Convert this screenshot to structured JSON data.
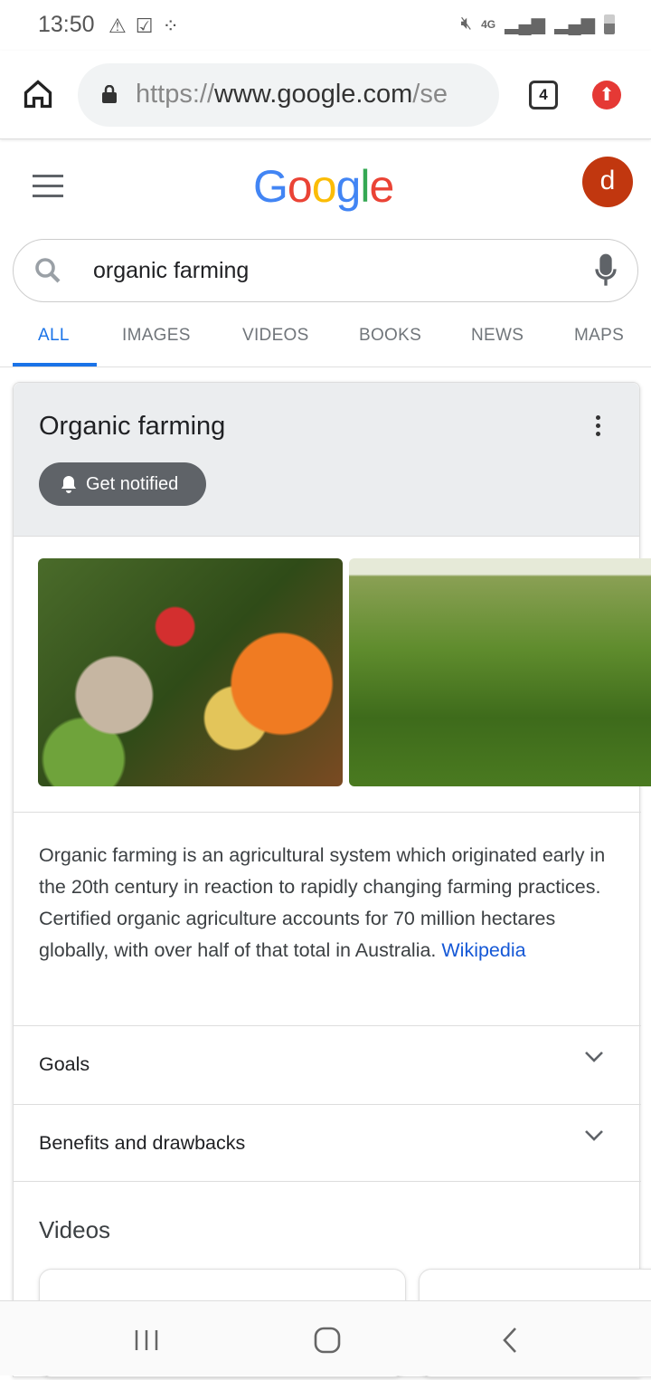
{
  "status_bar": {
    "time": "13:50",
    "left_icons": [
      "warning-icon",
      "checkbox-icon",
      "download-icon"
    ],
    "right_icons": [
      "mute-icon",
      "4g-icon",
      "signal-icon",
      "signal-icon",
      "battery-icon"
    ],
    "network": "4G"
  },
  "browser": {
    "url_scheme": "https://",
    "url_host": "www.google.com",
    "url_rest": "/se",
    "tab_count": "4"
  },
  "google": {
    "logo": "Google",
    "avatar_letter": "d",
    "search_query": "organic farming"
  },
  "tabs": [
    {
      "label": "ALL",
      "active": true
    },
    {
      "label": "IMAGES"
    },
    {
      "label": "VIDEOS"
    },
    {
      "label": "BOOKS"
    },
    {
      "label": "NEWS"
    },
    {
      "label": "MAPS"
    }
  ],
  "panel": {
    "title": "Organic farming",
    "notify_label": "Get notified",
    "description": "Organic farming is an agricultural system which originated early in the 20th century in reaction to rapidly changing farming practices. Certified organic agriculture accounts for 70 million hectares globally, with over half of that total in Australia. ",
    "source": "Wikipedia",
    "sections": [
      "Goals",
      "Benefits and drawbacks"
    ],
    "videos_heading": "Videos"
  },
  "colors": {
    "accent": "#1a73e8",
    "avatar": "#c1370f",
    "link": "#1558d6"
  }
}
